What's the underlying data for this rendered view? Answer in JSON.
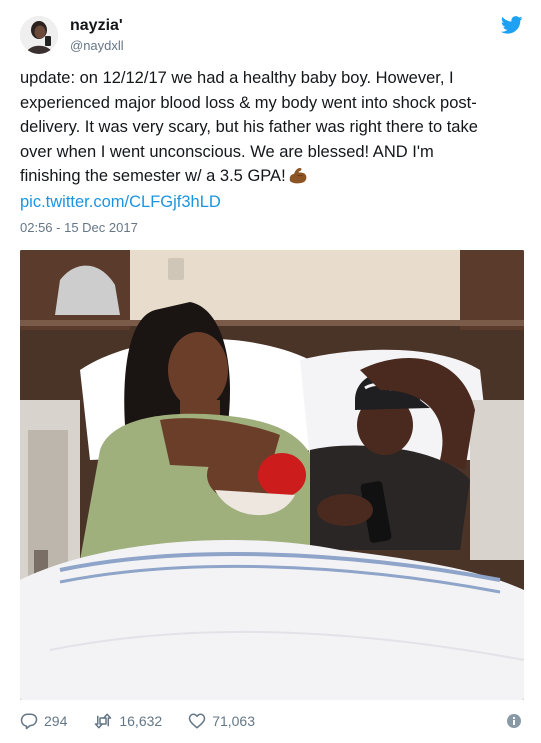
{
  "user": {
    "display_name": "nayzia'",
    "handle": "@naydxll"
  },
  "tweet": {
    "lines": [
      "update: on 12/12/17 we had a healthy baby boy. However, I",
      "experienced major blood loss & my body went into shock post-",
      "delivery. It was very scary, but his father was right there to take",
      "over when I went unconscious. We are blessed! AND I'm",
      "finishing the semester w/ a 3.5 GPA!"
    ],
    "emoji": "flexed-biceps-medium-dark-skin-tone",
    "link_text": "pic.twitter.com/CLFGjf3hLD",
    "timestamp": "02:56 - 15 Dec 2017"
  },
  "media": {
    "description_icon": "photo"
  },
  "stats": {
    "replies": "294",
    "retweets": "16,632",
    "likes": "71,063"
  },
  "colors": {
    "link": "#1b95e0",
    "muted": "#657786",
    "text": "#14171a",
    "twitter_blue": "#1da1f2"
  }
}
